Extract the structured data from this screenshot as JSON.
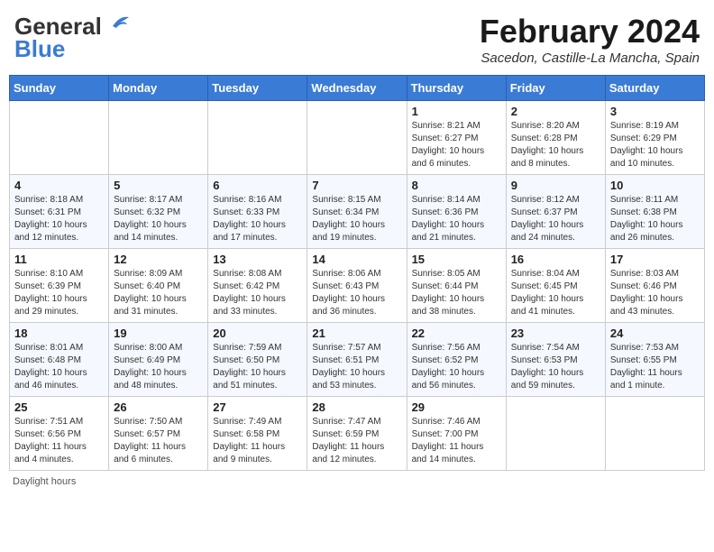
{
  "header": {
    "logo_line1": "General",
    "logo_line2": "Blue",
    "month_title": "February 2024",
    "location": "Sacedon, Castille-La Mancha, Spain"
  },
  "days_of_week": [
    "Sunday",
    "Monday",
    "Tuesday",
    "Wednesday",
    "Thursday",
    "Friday",
    "Saturday"
  ],
  "weeks": [
    [
      {
        "day": "",
        "info": ""
      },
      {
        "day": "",
        "info": ""
      },
      {
        "day": "",
        "info": ""
      },
      {
        "day": "",
        "info": ""
      },
      {
        "day": "1",
        "info": "Sunrise: 8:21 AM\nSunset: 6:27 PM\nDaylight: 10 hours\nand 6 minutes."
      },
      {
        "day": "2",
        "info": "Sunrise: 8:20 AM\nSunset: 6:28 PM\nDaylight: 10 hours\nand 8 minutes."
      },
      {
        "day": "3",
        "info": "Sunrise: 8:19 AM\nSunset: 6:29 PM\nDaylight: 10 hours\nand 10 minutes."
      }
    ],
    [
      {
        "day": "4",
        "info": "Sunrise: 8:18 AM\nSunset: 6:31 PM\nDaylight: 10 hours\nand 12 minutes."
      },
      {
        "day": "5",
        "info": "Sunrise: 8:17 AM\nSunset: 6:32 PM\nDaylight: 10 hours\nand 14 minutes."
      },
      {
        "day": "6",
        "info": "Sunrise: 8:16 AM\nSunset: 6:33 PM\nDaylight: 10 hours\nand 17 minutes."
      },
      {
        "day": "7",
        "info": "Sunrise: 8:15 AM\nSunset: 6:34 PM\nDaylight: 10 hours\nand 19 minutes."
      },
      {
        "day": "8",
        "info": "Sunrise: 8:14 AM\nSunset: 6:36 PM\nDaylight: 10 hours\nand 21 minutes."
      },
      {
        "day": "9",
        "info": "Sunrise: 8:12 AM\nSunset: 6:37 PM\nDaylight: 10 hours\nand 24 minutes."
      },
      {
        "day": "10",
        "info": "Sunrise: 8:11 AM\nSunset: 6:38 PM\nDaylight: 10 hours\nand 26 minutes."
      }
    ],
    [
      {
        "day": "11",
        "info": "Sunrise: 8:10 AM\nSunset: 6:39 PM\nDaylight: 10 hours\nand 29 minutes."
      },
      {
        "day": "12",
        "info": "Sunrise: 8:09 AM\nSunset: 6:40 PM\nDaylight: 10 hours\nand 31 minutes."
      },
      {
        "day": "13",
        "info": "Sunrise: 8:08 AM\nSunset: 6:42 PM\nDaylight: 10 hours\nand 33 minutes."
      },
      {
        "day": "14",
        "info": "Sunrise: 8:06 AM\nSunset: 6:43 PM\nDaylight: 10 hours\nand 36 minutes."
      },
      {
        "day": "15",
        "info": "Sunrise: 8:05 AM\nSunset: 6:44 PM\nDaylight: 10 hours\nand 38 minutes."
      },
      {
        "day": "16",
        "info": "Sunrise: 8:04 AM\nSunset: 6:45 PM\nDaylight: 10 hours\nand 41 minutes."
      },
      {
        "day": "17",
        "info": "Sunrise: 8:03 AM\nSunset: 6:46 PM\nDaylight: 10 hours\nand 43 minutes."
      }
    ],
    [
      {
        "day": "18",
        "info": "Sunrise: 8:01 AM\nSunset: 6:48 PM\nDaylight: 10 hours\nand 46 minutes."
      },
      {
        "day": "19",
        "info": "Sunrise: 8:00 AM\nSunset: 6:49 PM\nDaylight: 10 hours\nand 48 minutes."
      },
      {
        "day": "20",
        "info": "Sunrise: 7:59 AM\nSunset: 6:50 PM\nDaylight: 10 hours\nand 51 minutes."
      },
      {
        "day": "21",
        "info": "Sunrise: 7:57 AM\nSunset: 6:51 PM\nDaylight: 10 hours\nand 53 minutes."
      },
      {
        "day": "22",
        "info": "Sunrise: 7:56 AM\nSunset: 6:52 PM\nDaylight: 10 hours\nand 56 minutes."
      },
      {
        "day": "23",
        "info": "Sunrise: 7:54 AM\nSunset: 6:53 PM\nDaylight: 10 hours\nand 59 minutes."
      },
      {
        "day": "24",
        "info": "Sunrise: 7:53 AM\nSunset: 6:55 PM\nDaylight: 11 hours\nand 1 minute."
      }
    ],
    [
      {
        "day": "25",
        "info": "Sunrise: 7:51 AM\nSunset: 6:56 PM\nDaylight: 11 hours\nand 4 minutes."
      },
      {
        "day": "26",
        "info": "Sunrise: 7:50 AM\nSunset: 6:57 PM\nDaylight: 11 hours\nand 6 minutes."
      },
      {
        "day": "27",
        "info": "Sunrise: 7:49 AM\nSunset: 6:58 PM\nDaylight: 11 hours\nand 9 minutes."
      },
      {
        "day": "28",
        "info": "Sunrise: 7:47 AM\nSunset: 6:59 PM\nDaylight: 11 hours\nand 12 minutes."
      },
      {
        "day": "29",
        "info": "Sunrise: 7:46 AM\nSunset: 7:00 PM\nDaylight: 11 hours\nand 14 minutes."
      },
      {
        "day": "",
        "info": ""
      },
      {
        "day": "",
        "info": ""
      }
    ]
  ],
  "footer": {
    "daylight_note": "Daylight hours"
  }
}
